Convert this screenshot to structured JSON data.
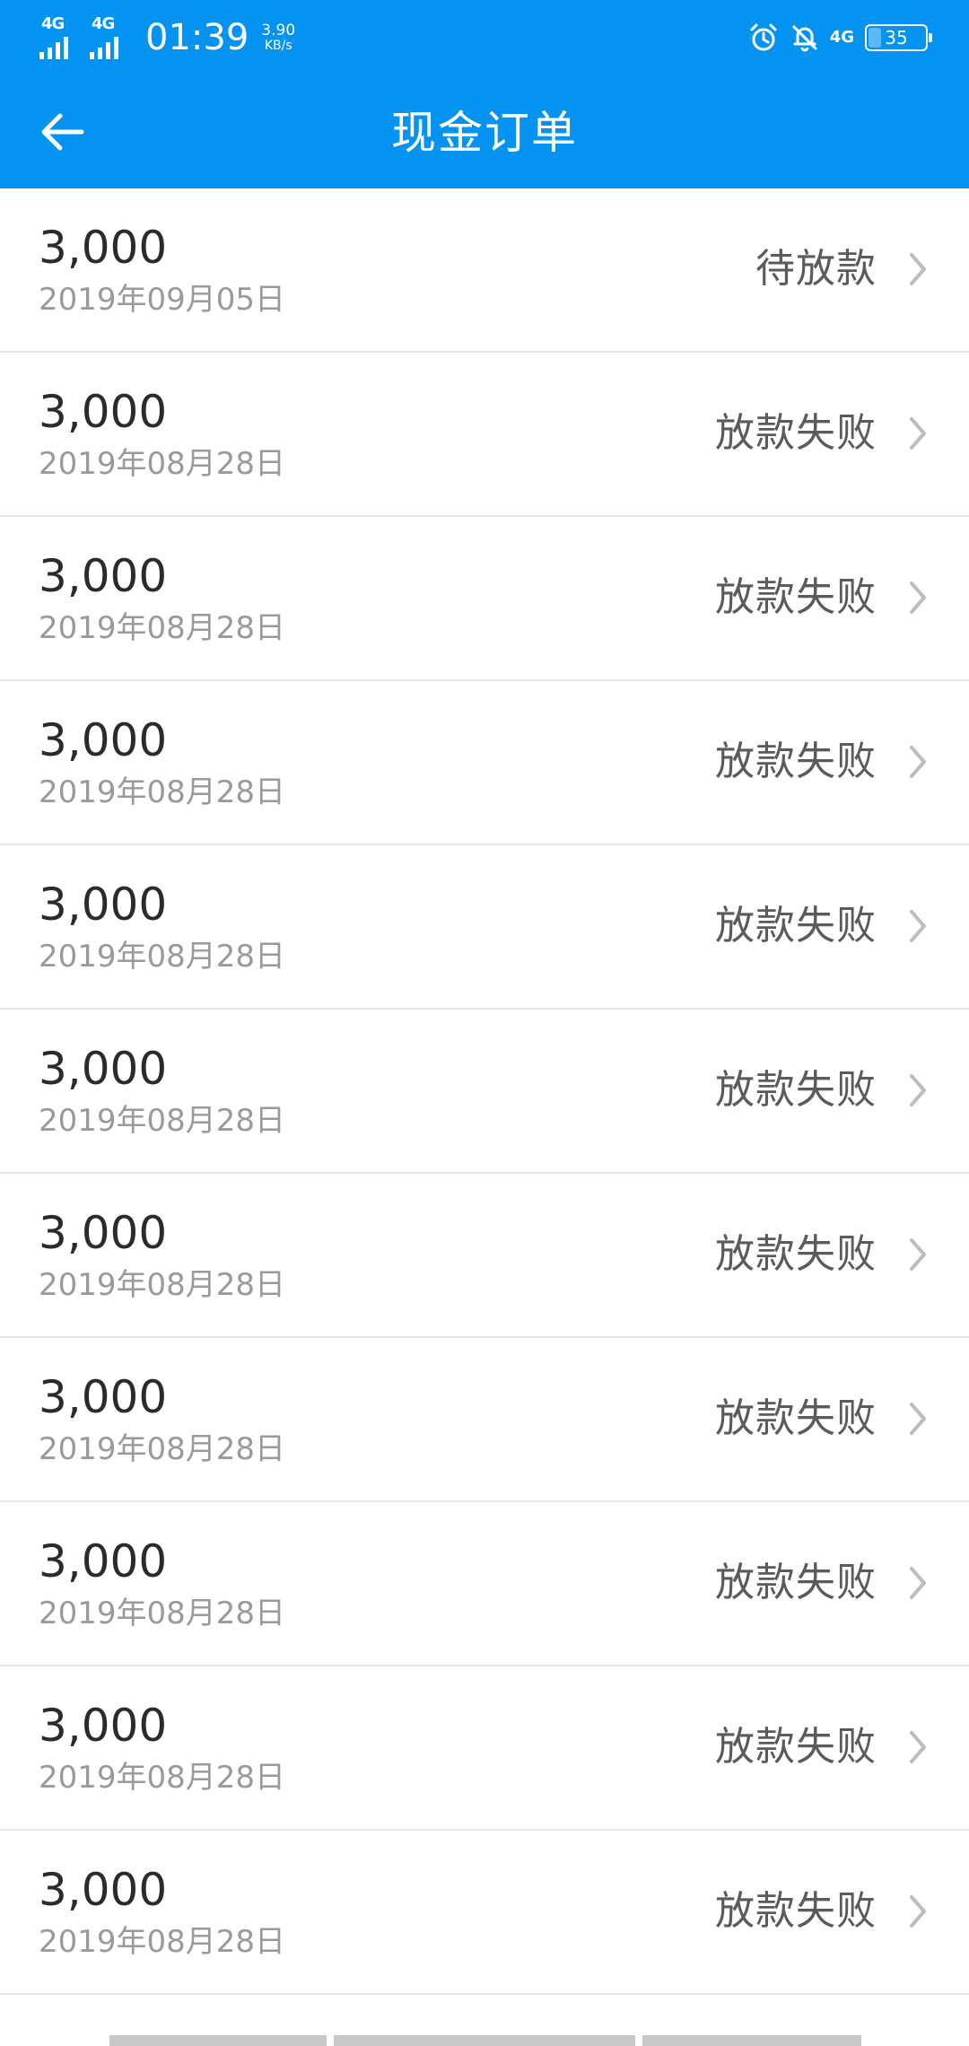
{
  "status_bar": {
    "sim1_label": "4G",
    "sim2_label": "4G",
    "time": "01:39",
    "net_speed_value": "3.90",
    "net_speed_unit": "KB/s",
    "alarm_icon": "alarm-clock-icon",
    "mute_icon": "bell-off-icon",
    "data_label": "4G",
    "battery_level": "35"
  },
  "header": {
    "back_icon": "arrow-left-icon",
    "title": "现金订单"
  },
  "orders": [
    {
      "amount": "3,000",
      "date": "2019年09月05日",
      "status": "待放款"
    },
    {
      "amount": "3,000",
      "date": "2019年08月28日",
      "status": "放款失败"
    },
    {
      "amount": "3,000",
      "date": "2019年08月28日",
      "status": "放款失败"
    },
    {
      "amount": "3,000",
      "date": "2019年08月28日",
      "status": "放款失败"
    },
    {
      "amount": "3,000",
      "date": "2019年08月28日",
      "status": "放款失败"
    },
    {
      "amount": "3,000",
      "date": "2019年08月28日",
      "status": "放款失败"
    },
    {
      "amount": "3,000",
      "date": "2019年08月28日",
      "status": "放款失败"
    },
    {
      "amount": "3,000",
      "date": "2019年08月28日",
      "status": "放款失败"
    },
    {
      "amount": "3,000",
      "date": "2019年08月28日",
      "status": "放款失败"
    },
    {
      "amount": "3,000",
      "date": "2019年08月28日",
      "status": "放款失败"
    },
    {
      "amount": "3,000",
      "date": "2019年08月28日",
      "status": "放款失败"
    }
  ],
  "colors": {
    "primary": "#0593f2",
    "amount_text": "#2b2b2b",
    "date_text": "#9a9a9a",
    "status_text": "#5b5b5b",
    "divider": "#e6e6e6"
  }
}
